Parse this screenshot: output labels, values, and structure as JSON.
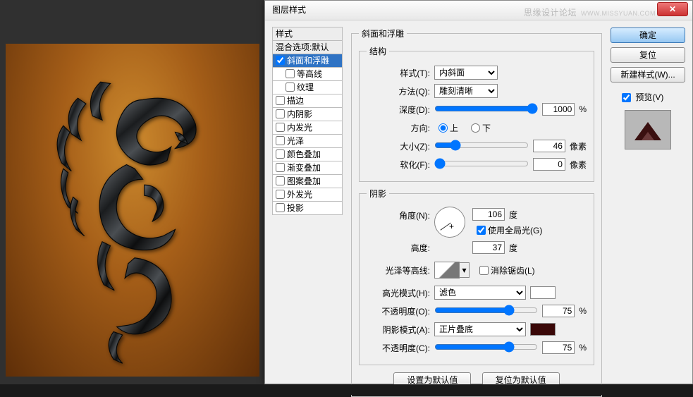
{
  "watermark": {
    "text": "思缘设计论坛",
    "url": "WWW.MISSYUAN.COM"
  },
  "dialog": {
    "title": "图层样式",
    "styles_header": "样式",
    "blend_opts": "混合选项:默认",
    "effects": {
      "bevel": {
        "label": "斜面和浮雕",
        "on": true
      },
      "contour": {
        "label": "等高线",
        "on": false
      },
      "texture": {
        "label": "纹理",
        "on": false
      },
      "stroke": {
        "label": "描边",
        "on": false
      },
      "inner_shadow": {
        "label": "内阴影",
        "on": false
      },
      "inner_glow": {
        "label": "内发光",
        "on": false
      },
      "satin": {
        "label": "光泽",
        "on": false
      },
      "color_overlay": {
        "label": "颜色叠加",
        "on": false
      },
      "grad_overlay": {
        "label": "渐变叠加",
        "on": false
      },
      "pat_overlay": {
        "label": "图案叠加",
        "on": false
      },
      "outer_glow": {
        "label": "外发光",
        "on": false
      },
      "drop_shadow": {
        "label": "投影",
        "on": false
      }
    },
    "panel_title": "斜面和浮雕",
    "structure": {
      "legend": "结构",
      "style_lbl": "样式(T):",
      "style_val": "内斜面",
      "tech_lbl": "方法(Q):",
      "tech_val": "雕刻清晰",
      "depth_lbl": "深度(D):",
      "depth_val": "1000",
      "depth_unit": "%",
      "dir_lbl": "方向:",
      "dir_up": "上",
      "dir_down": "下",
      "size_lbl": "大小(Z):",
      "size_val": "46",
      "size_unit": "像素",
      "soft_lbl": "软化(F):",
      "soft_val": "0",
      "soft_unit": "像素"
    },
    "shading": {
      "legend": "阴影",
      "angle_lbl": "角度(N):",
      "angle_val": "106",
      "angle_unit": "度",
      "global_lbl": "使用全局光(G)",
      "alt_lbl": "高度:",
      "alt_val": "37",
      "alt_unit": "度",
      "gloss_lbl": "光泽等高线:",
      "aa_lbl": "消除锯齿(L)",
      "hl_mode_lbl": "高光模式(H):",
      "hl_mode_val": "滤色",
      "hl_op_lbl": "不透明度(O):",
      "hl_op_val": "75",
      "op_unit": "%",
      "sh_mode_lbl": "阴影模式(A):",
      "sh_mode_val": "正片叠底",
      "sh_op_lbl": "不透明度(C):",
      "sh_op_val": "75"
    },
    "defaults": {
      "set": "设置为默认值",
      "reset": "复位为默认值"
    },
    "buttons": {
      "ok": "确定",
      "cancel": "复位",
      "new_style": "新建样式(W)...",
      "preview": "预览(V)"
    }
  }
}
